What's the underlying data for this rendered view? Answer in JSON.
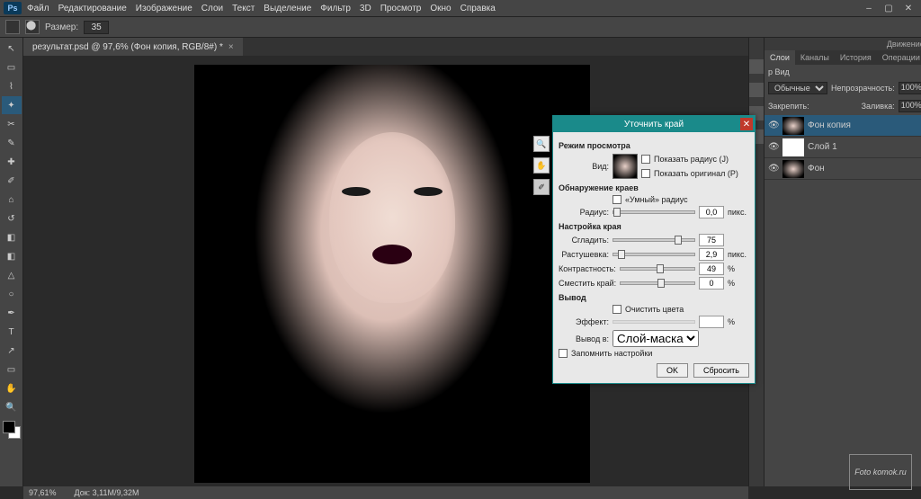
{
  "menu": {
    "items": [
      "Файл",
      "Редактирование",
      "Изображение",
      "Слои",
      "Текст",
      "Выделение",
      "Фильтр",
      "3D",
      "Просмотр",
      "Окно",
      "Справка"
    ]
  },
  "optionbar": {
    "size_label": "Размер:",
    "size_value": "35"
  },
  "doc": {
    "tab_title": "результат.psd @ 97,6% (Фон копия, RGB/8#) *"
  },
  "footer": {
    "zoom": "97,61%",
    "docinfo": "Док: 3,11M/9,32M"
  },
  "panels": {
    "top_small": "Движение",
    "tabs": [
      "Слои",
      "Каналы",
      "История",
      "Операции"
    ],
    "kind_label": "p Вид",
    "blend": "Обычные",
    "opacity_label": "Непрозрачность:",
    "opacity_val": "100%",
    "lock_label": "Закрепить:",
    "fill_label": "Заливка:",
    "fill_val": "100%",
    "layers": [
      {
        "name": "Фон копия",
        "sel": true,
        "thumb": "p"
      },
      {
        "name": "Слой 1",
        "sel": false,
        "thumb": "w"
      },
      {
        "name": "Фон",
        "sel": false,
        "thumb": "p"
      }
    ]
  },
  "dialog": {
    "title": "Уточнить край",
    "view_section": "Режим просмотра",
    "view_label": "Вид:",
    "show_radius": "Показать радиус (J)",
    "show_original": "Показать оригинал (P)",
    "detect_section": "Обнаружение краев",
    "smart_radius": "«Умный» радиус",
    "radius_label": "Радиус:",
    "radius_val": "0,0",
    "radius_unit": "пикс.",
    "adjust_section": "Настройка края",
    "smooth_label": "Сгладить:",
    "smooth_val": "75",
    "feather_label": "Растушевка:",
    "feather_val": "2,9",
    "feather_unit": "пикс.",
    "contrast_label": "Контрастность:",
    "contrast_val": "49",
    "contrast_unit": "%",
    "shift_label": "Сместить край:",
    "shift_val": "0",
    "shift_unit": "%",
    "output_section": "Вывод",
    "decontaminate": "Очистить цвета",
    "amount_label": "Эффект:",
    "amount_unit": "%",
    "output_to_label": "Вывод в:",
    "output_to_value": "Слой-маска",
    "remember": "Запомнить настройки",
    "ok": "OK",
    "reset": "Сбросить"
  },
  "watermark": "Foto komok.ru"
}
